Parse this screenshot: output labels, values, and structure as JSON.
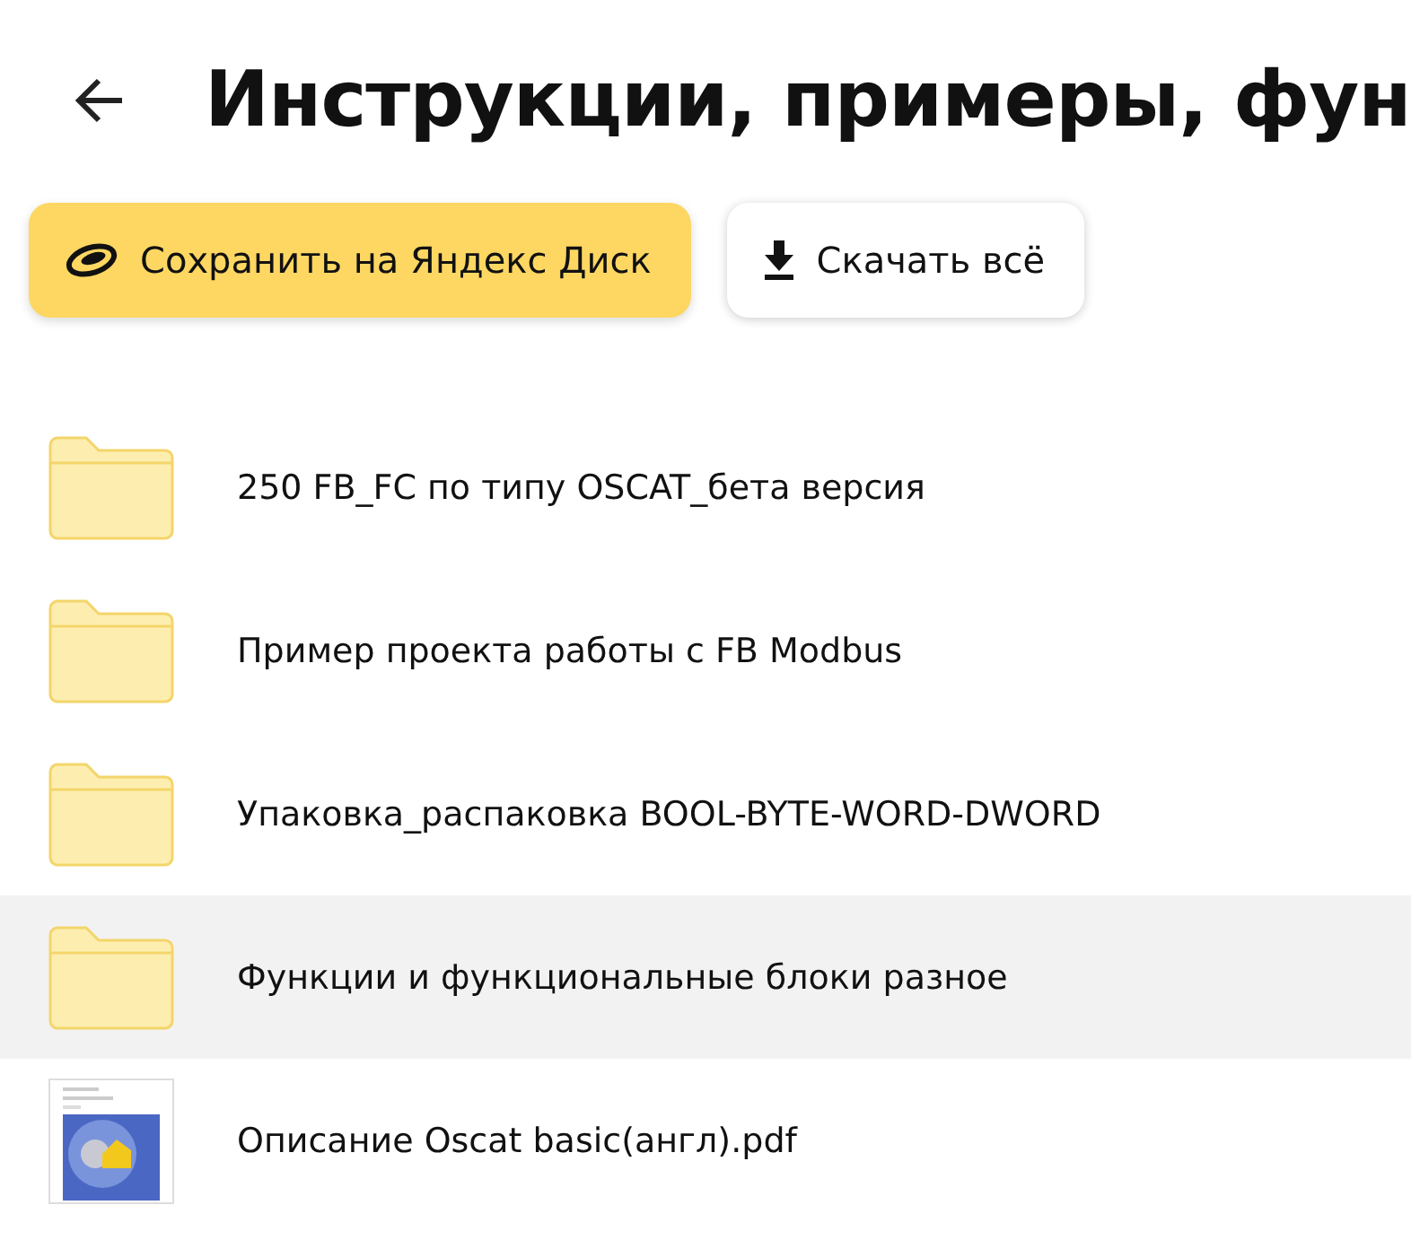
{
  "header": {
    "title": "Инструкции, примеры, фун"
  },
  "buttons": [
    {
      "kind": "save",
      "label": "Сохранить на Яндекс Диск"
    },
    {
      "kind": "download",
      "label": "Скачать всё"
    }
  ],
  "items": [
    {
      "kind": "folder",
      "name": "250 FB_FC по типу OSCAT_бета версия",
      "selected": false
    },
    {
      "kind": "folder",
      "name": "Пример проекта работы с FB Modbus",
      "selected": false
    },
    {
      "kind": "folder",
      "name": "Упаковка_распаковка BOOL-BYTE-WORD-DWORD",
      "selected": false
    },
    {
      "kind": "folder",
      "name": "Функции и функциональные блоки разное",
      "selected": true
    },
    {
      "kind": "file",
      "name": "Описание Oscat basic(англ).pdf",
      "selected": false
    }
  ]
}
